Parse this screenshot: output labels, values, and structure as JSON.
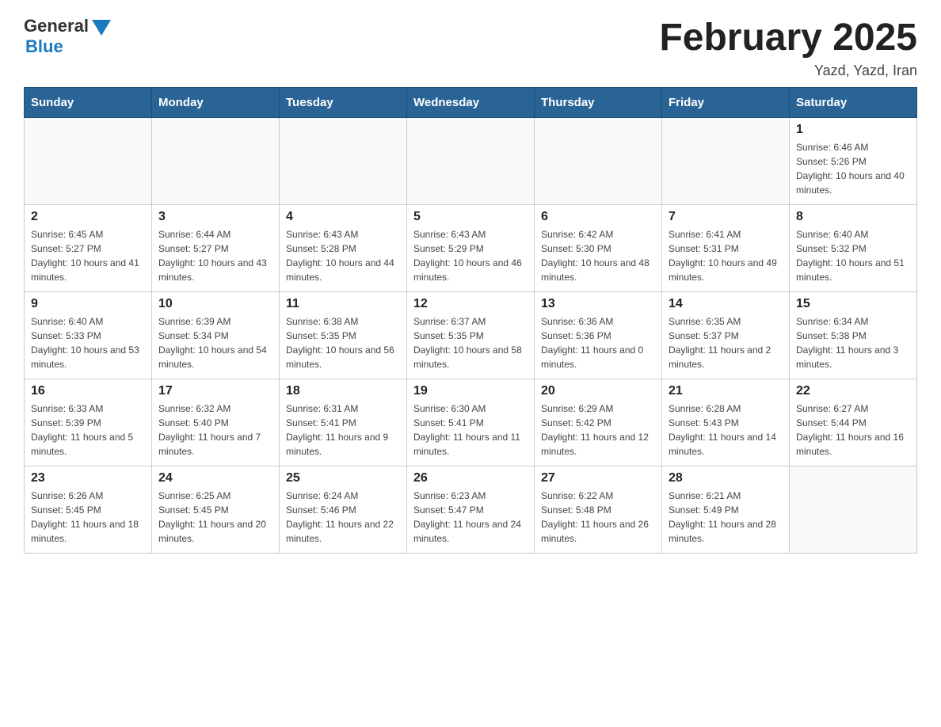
{
  "header": {
    "logo_general": "General",
    "logo_blue": "Blue",
    "month_title": "February 2025",
    "location": "Yazd, Yazd, Iran"
  },
  "days_of_week": [
    "Sunday",
    "Monday",
    "Tuesday",
    "Wednesday",
    "Thursday",
    "Friday",
    "Saturday"
  ],
  "weeks": [
    [
      {
        "day": "",
        "sunrise": "",
        "sunset": "",
        "daylight": ""
      },
      {
        "day": "",
        "sunrise": "",
        "sunset": "",
        "daylight": ""
      },
      {
        "day": "",
        "sunrise": "",
        "sunset": "",
        "daylight": ""
      },
      {
        "day": "",
        "sunrise": "",
        "sunset": "",
        "daylight": ""
      },
      {
        "day": "",
        "sunrise": "",
        "sunset": "",
        "daylight": ""
      },
      {
        "day": "",
        "sunrise": "",
        "sunset": "",
        "daylight": ""
      },
      {
        "day": "1",
        "sunrise": "Sunrise: 6:46 AM",
        "sunset": "Sunset: 5:26 PM",
        "daylight": "Daylight: 10 hours and 40 minutes."
      }
    ],
    [
      {
        "day": "2",
        "sunrise": "Sunrise: 6:45 AM",
        "sunset": "Sunset: 5:27 PM",
        "daylight": "Daylight: 10 hours and 41 minutes."
      },
      {
        "day": "3",
        "sunrise": "Sunrise: 6:44 AM",
        "sunset": "Sunset: 5:27 PM",
        "daylight": "Daylight: 10 hours and 43 minutes."
      },
      {
        "day": "4",
        "sunrise": "Sunrise: 6:43 AM",
        "sunset": "Sunset: 5:28 PM",
        "daylight": "Daylight: 10 hours and 44 minutes."
      },
      {
        "day": "5",
        "sunrise": "Sunrise: 6:43 AM",
        "sunset": "Sunset: 5:29 PM",
        "daylight": "Daylight: 10 hours and 46 minutes."
      },
      {
        "day": "6",
        "sunrise": "Sunrise: 6:42 AM",
        "sunset": "Sunset: 5:30 PM",
        "daylight": "Daylight: 10 hours and 48 minutes."
      },
      {
        "day": "7",
        "sunrise": "Sunrise: 6:41 AM",
        "sunset": "Sunset: 5:31 PM",
        "daylight": "Daylight: 10 hours and 49 minutes."
      },
      {
        "day": "8",
        "sunrise": "Sunrise: 6:40 AM",
        "sunset": "Sunset: 5:32 PM",
        "daylight": "Daylight: 10 hours and 51 minutes."
      }
    ],
    [
      {
        "day": "9",
        "sunrise": "Sunrise: 6:40 AM",
        "sunset": "Sunset: 5:33 PM",
        "daylight": "Daylight: 10 hours and 53 minutes."
      },
      {
        "day": "10",
        "sunrise": "Sunrise: 6:39 AM",
        "sunset": "Sunset: 5:34 PM",
        "daylight": "Daylight: 10 hours and 54 minutes."
      },
      {
        "day": "11",
        "sunrise": "Sunrise: 6:38 AM",
        "sunset": "Sunset: 5:35 PM",
        "daylight": "Daylight: 10 hours and 56 minutes."
      },
      {
        "day": "12",
        "sunrise": "Sunrise: 6:37 AM",
        "sunset": "Sunset: 5:35 PM",
        "daylight": "Daylight: 10 hours and 58 minutes."
      },
      {
        "day": "13",
        "sunrise": "Sunrise: 6:36 AM",
        "sunset": "Sunset: 5:36 PM",
        "daylight": "Daylight: 11 hours and 0 minutes."
      },
      {
        "day": "14",
        "sunrise": "Sunrise: 6:35 AM",
        "sunset": "Sunset: 5:37 PM",
        "daylight": "Daylight: 11 hours and 2 minutes."
      },
      {
        "day": "15",
        "sunrise": "Sunrise: 6:34 AM",
        "sunset": "Sunset: 5:38 PM",
        "daylight": "Daylight: 11 hours and 3 minutes."
      }
    ],
    [
      {
        "day": "16",
        "sunrise": "Sunrise: 6:33 AM",
        "sunset": "Sunset: 5:39 PM",
        "daylight": "Daylight: 11 hours and 5 minutes."
      },
      {
        "day": "17",
        "sunrise": "Sunrise: 6:32 AM",
        "sunset": "Sunset: 5:40 PM",
        "daylight": "Daylight: 11 hours and 7 minutes."
      },
      {
        "day": "18",
        "sunrise": "Sunrise: 6:31 AM",
        "sunset": "Sunset: 5:41 PM",
        "daylight": "Daylight: 11 hours and 9 minutes."
      },
      {
        "day": "19",
        "sunrise": "Sunrise: 6:30 AM",
        "sunset": "Sunset: 5:41 PM",
        "daylight": "Daylight: 11 hours and 11 minutes."
      },
      {
        "day": "20",
        "sunrise": "Sunrise: 6:29 AM",
        "sunset": "Sunset: 5:42 PM",
        "daylight": "Daylight: 11 hours and 12 minutes."
      },
      {
        "day": "21",
        "sunrise": "Sunrise: 6:28 AM",
        "sunset": "Sunset: 5:43 PM",
        "daylight": "Daylight: 11 hours and 14 minutes."
      },
      {
        "day": "22",
        "sunrise": "Sunrise: 6:27 AM",
        "sunset": "Sunset: 5:44 PM",
        "daylight": "Daylight: 11 hours and 16 minutes."
      }
    ],
    [
      {
        "day": "23",
        "sunrise": "Sunrise: 6:26 AM",
        "sunset": "Sunset: 5:45 PM",
        "daylight": "Daylight: 11 hours and 18 minutes."
      },
      {
        "day": "24",
        "sunrise": "Sunrise: 6:25 AM",
        "sunset": "Sunset: 5:45 PM",
        "daylight": "Daylight: 11 hours and 20 minutes."
      },
      {
        "day": "25",
        "sunrise": "Sunrise: 6:24 AM",
        "sunset": "Sunset: 5:46 PM",
        "daylight": "Daylight: 11 hours and 22 minutes."
      },
      {
        "day": "26",
        "sunrise": "Sunrise: 6:23 AM",
        "sunset": "Sunset: 5:47 PM",
        "daylight": "Daylight: 11 hours and 24 minutes."
      },
      {
        "day": "27",
        "sunrise": "Sunrise: 6:22 AM",
        "sunset": "Sunset: 5:48 PM",
        "daylight": "Daylight: 11 hours and 26 minutes."
      },
      {
        "day": "28",
        "sunrise": "Sunrise: 6:21 AM",
        "sunset": "Sunset: 5:49 PM",
        "daylight": "Daylight: 11 hours and 28 minutes."
      },
      {
        "day": "",
        "sunrise": "",
        "sunset": "",
        "daylight": ""
      }
    ]
  ]
}
